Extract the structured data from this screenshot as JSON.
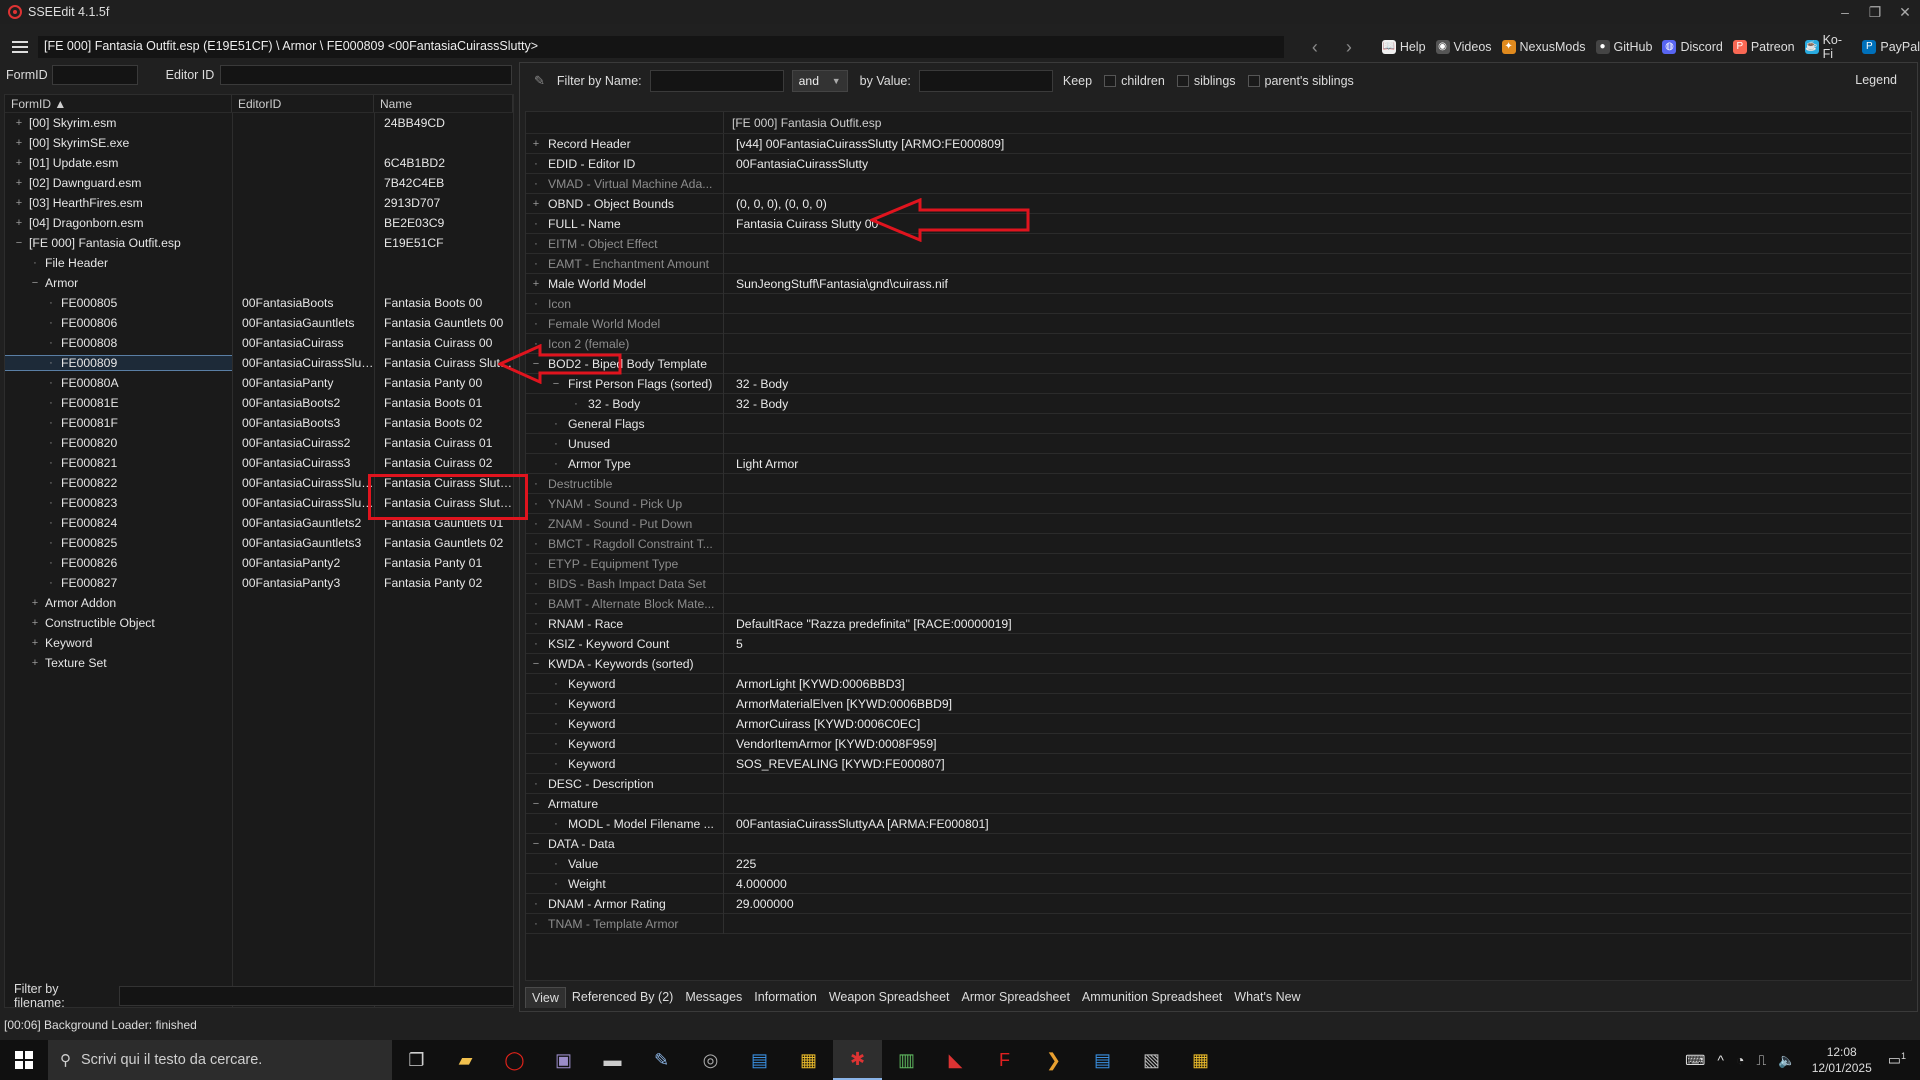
{
  "window": {
    "title": "SSEEdit 4.1.5f"
  },
  "pathbar": {
    "path": "[FE 000] Fantasia Outfit.esp (E19E51CF) \\ Armor \\ FE000809 <00FantasiaCuirassSlutty>"
  },
  "links": [
    {
      "label": "Help",
      "color": "#f0f0f0",
      "glyph": "📖"
    },
    {
      "label": "Videos",
      "color": "#555555",
      "glyph": "◉"
    },
    {
      "label": "NexusMods",
      "color": "#e08a1e",
      "glyph": "✦"
    },
    {
      "label": "GitHub",
      "color": "#444444",
      "glyph": "●"
    },
    {
      "label": "Discord",
      "color": "#5865f2",
      "glyph": "◍"
    },
    {
      "label": "Patreon",
      "color": "#f96854",
      "glyph": "P"
    },
    {
      "label": "Ko-Fi",
      "color": "#29abe0",
      "glyph": "☕"
    },
    {
      "label": "PayPal",
      "color": "#0070ba",
      "glyph": "P"
    }
  ],
  "left": {
    "formid_label": "FormID",
    "editorid_label": "Editor ID",
    "columns": [
      "FormID",
      "EditorID",
      "Name"
    ],
    "rows": [
      {
        "exp": "+",
        "level": 0,
        "c1": "[00] Skyrim.esm",
        "c2": "",
        "c3": "24BB49CD"
      },
      {
        "exp": "+",
        "level": 0,
        "c1": "[00] SkyrimSE.exe",
        "c2": "",
        "c3": ""
      },
      {
        "exp": "+",
        "level": 0,
        "c1": "[01] Update.esm",
        "c2": "",
        "c3": "6C4B1BD2"
      },
      {
        "exp": "+",
        "level": 0,
        "c1": "[02] Dawnguard.esm",
        "c2": "",
        "c3": "7B42C4EB"
      },
      {
        "exp": "+",
        "level": 0,
        "c1": "[03] HearthFires.esm",
        "c2": "",
        "c3": "2913D707"
      },
      {
        "exp": "+",
        "level": 0,
        "c1": "[04] Dragonborn.esm",
        "c2": "",
        "c3": "BE2E03C9"
      },
      {
        "exp": "−",
        "level": 0,
        "c1": "[FE 000] Fantasia Outfit.esp",
        "c2": "",
        "c3": "E19E51CF"
      },
      {
        "exp": "",
        "level": 1,
        "c1": "File Header",
        "c2": "",
        "c3": ""
      },
      {
        "exp": "−",
        "level": 1,
        "c1": "Armor",
        "c2": "",
        "c3": ""
      },
      {
        "exp": "",
        "level": 2,
        "c1": "FE000805",
        "c2": "00FantasiaBoots",
        "c3": "Fantasia Boots 00"
      },
      {
        "exp": "",
        "level": 2,
        "c1": "FE000806",
        "c2": "00FantasiaGauntlets",
        "c3": "Fantasia Gauntlets 00"
      },
      {
        "exp": "",
        "level": 2,
        "c1": "FE000808",
        "c2": "00FantasiaCuirass",
        "c3": "Fantasia Cuirass 00"
      },
      {
        "exp": "",
        "level": 2,
        "c1": "FE000809",
        "c2": "00FantasiaCuirassSlutty",
        "c3": "Fantasia Cuirass Slutt...",
        "selected": true
      },
      {
        "exp": "",
        "level": 2,
        "c1": "FE00080A",
        "c2": "00FantasiaPanty",
        "c3": "Fantasia Panty 00"
      },
      {
        "exp": "",
        "level": 2,
        "c1": "FE00081E",
        "c2": "00FantasiaBoots2",
        "c3": "Fantasia Boots 01"
      },
      {
        "exp": "",
        "level": 2,
        "c1": "FE00081F",
        "c2": "00FantasiaBoots3",
        "c3": "Fantasia Boots 02"
      },
      {
        "exp": "",
        "level": 2,
        "c1": "FE000820",
        "c2": "00FantasiaCuirass2",
        "c3": "Fantasia Cuirass 01"
      },
      {
        "exp": "",
        "level": 2,
        "c1": "FE000821",
        "c2": "00FantasiaCuirass3",
        "c3": "Fantasia Cuirass 02"
      },
      {
        "exp": "",
        "level": 2,
        "c1": "FE000822",
        "c2": "00FantasiaCuirassSlut...",
        "c3": "Fantasia Cuirass Slutt..."
      },
      {
        "exp": "",
        "level": 2,
        "c1": "FE000823",
        "c2": "00FantasiaCuirassSlut...",
        "c3": "Fantasia Cuirass Slutt..."
      },
      {
        "exp": "",
        "level": 2,
        "c1": "FE000824",
        "c2": "00FantasiaGauntlets2",
        "c3": "Fantasia Gauntlets 01"
      },
      {
        "exp": "",
        "level": 2,
        "c1": "FE000825",
        "c2": "00FantasiaGauntlets3",
        "c3": "Fantasia Gauntlets 02"
      },
      {
        "exp": "",
        "level": 2,
        "c1": "FE000826",
        "c2": "00FantasiaPanty2",
        "c3": "Fantasia Panty 01"
      },
      {
        "exp": "",
        "level": 2,
        "c1": "FE000827",
        "c2": "00FantasiaPanty3",
        "c3": "Fantasia Panty 02"
      },
      {
        "exp": "+",
        "level": 1,
        "c1": "Armor Addon",
        "c2": "",
        "c3": ""
      },
      {
        "exp": "+",
        "level": 1,
        "c1": "Constructible Object",
        "c2": "",
        "c3": ""
      },
      {
        "exp": "+",
        "level": 1,
        "c1": "Keyword",
        "c2": "",
        "c3": ""
      },
      {
        "exp": "+",
        "level": 1,
        "c1": "Texture Set",
        "c2": "",
        "c3": ""
      }
    ],
    "filter_by_filename": "Filter by filename:"
  },
  "status": "[00:06] Background Loader: finished",
  "right": {
    "filter_name_label": "Filter by Name:",
    "and_label": "and",
    "by_value_label": "by Value:",
    "keep_label": "Keep",
    "children_label": "children",
    "siblings_label": "siblings",
    "parents_label": "parent's siblings",
    "legend_label": "Legend",
    "column_header": "[FE 000] Fantasia Outfit.esp",
    "rows": [
      {
        "exp": "+",
        "ind": 0,
        "k": "Record Header",
        "v": "[v44] 00FantasiaCuirassSlutty [ARMO:FE000809]"
      },
      {
        "exp": "",
        "ind": 0,
        "k": "EDID - Editor ID",
        "v": "00FantasiaCuirassSlutty"
      },
      {
        "exp": "",
        "ind": 0,
        "k": "VMAD - Virtual Machine Ada...",
        "v": "",
        "dim": true
      },
      {
        "exp": "+",
        "ind": 0,
        "k": "OBND - Object Bounds",
        "v": "(0, 0, 0), (0, 0, 0)"
      },
      {
        "exp": "",
        "ind": 0,
        "k": "FULL - Name",
        "v": "Fantasia Cuirass Slutty 00"
      },
      {
        "exp": "",
        "ind": 0,
        "k": "EITM - Object Effect",
        "v": "",
        "dim": true
      },
      {
        "exp": "",
        "ind": 0,
        "k": "EAMT - Enchantment Amount",
        "v": "",
        "dim": true
      },
      {
        "exp": "+",
        "ind": 0,
        "k": "Male World Model",
        "v": "SunJeongStuff\\Fantasia\\gnd\\cuirass.nif"
      },
      {
        "exp": "",
        "ind": 0,
        "k": "Icon",
        "v": "",
        "dim": true
      },
      {
        "exp": "",
        "ind": 0,
        "k": "Female World Model",
        "v": "",
        "dim": true
      },
      {
        "exp": "",
        "ind": 0,
        "k": "Icon 2 (female)",
        "v": "",
        "dim": true
      },
      {
        "exp": "−",
        "ind": 0,
        "k": "BOD2 - Biped Body Template",
        "v": ""
      },
      {
        "exp": "−",
        "ind": 1,
        "k": "First Person Flags (sorted)",
        "v": "32 - Body"
      },
      {
        "exp": "",
        "ind": 2,
        "k": "32 - Body",
        "v": "32 - Body"
      },
      {
        "exp": "",
        "ind": 1,
        "k": "General Flags",
        "v": ""
      },
      {
        "exp": "",
        "ind": 1,
        "k": "Unused",
        "v": ""
      },
      {
        "exp": "",
        "ind": 1,
        "k": "Armor Type",
        "v": "Light Armor"
      },
      {
        "exp": "",
        "ind": 0,
        "k": "Destructible",
        "v": "",
        "dim": true
      },
      {
        "exp": "",
        "ind": 0,
        "k": "YNAM - Sound - Pick Up",
        "v": "",
        "dim": true
      },
      {
        "exp": "",
        "ind": 0,
        "k": "ZNAM - Sound - Put Down",
        "v": "",
        "dim": true
      },
      {
        "exp": "",
        "ind": 0,
        "k": "BMCT - Ragdoll Constraint T...",
        "v": "",
        "dim": true
      },
      {
        "exp": "",
        "ind": 0,
        "k": "ETYP - Equipment Type",
        "v": "",
        "dim": true
      },
      {
        "exp": "",
        "ind": 0,
        "k": "BIDS - Bash Impact Data Set",
        "v": "",
        "dim": true
      },
      {
        "exp": "",
        "ind": 0,
        "k": "BAMT - Alternate Block Mate...",
        "v": "",
        "dim": true
      },
      {
        "exp": "",
        "ind": 0,
        "k": "RNAM - Race",
        "v": "DefaultRace \"Razza predefinita\" [RACE:00000019]"
      },
      {
        "exp": "",
        "ind": 0,
        "k": "KSIZ - Keyword Count",
        "v": "5"
      },
      {
        "exp": "−",
        "ind": 0,
        "k": "KWDA - Keywords (sorted)",
        "v": ""
      },
      {
        "exp": "",
        "ind": 1,
        "k": "Keyword",
        "v": "ArmorLight [KYWD:0006BBD3]"
      },
      {
        "exp": "",
        "ind": 1,
        "k": "Keyword",
        "v": "ArmorMaterialElven [KYWD:0006BBD9]"
      },
      {
        "exp": "",
        "ind": 1,
        "k": "Keyword",
        "v": "ArmorCuirass [KYWD:0006C0EC]"
      },
      {
        "exp": "",
        "ind": 1,
        "k": "Keyword",
        "v": "VendorItemArmor [KYWD:0008F959]"
      },
      {
        "exp": "",
        "ind": 1,
        "k": "Keyword",
        "v": "SOS_REVEALING [KYWD:FE000807]"
      },
      {
        "exp": "",
        "ind": 0,
        "k": "DESC - Description",
        "v": ""
      },
      {
        "exp": "−",
        "ind": 0,
        "k": "Armature",
        "v": ""
      },
      {
        "exp": "",
        "ind": 1,
        "k": "MODL - Model Filename ...",
        "v": "00FantasiaCuirassSluttyAA [ARMA:FE000801]"
      },
      {
        "exp": "−",
        "ind": 0,
        "k": "DATA - Data",
        "v": ""
      },
      {
        "exp": "",
        "ind": 1,
        "k": "Value",
        "v": "225"
      },
      {
        "exp": "",
        "ind": 1,
        "k": "Weight",
        "v": "4.000000"
      },
      {
        "exp": "",
        "ind": 0,
        "k": "DNAM - Armor Rating",
        "v": "29.000000"
      },
      {
        "exp": "",
        "ind": 0,
        "k": "TNAM - Template Armor",
        "v": "",
        "dim": true
      }
    ],
    "tabs": [
      "View",
      "Referenced By (2)",
      "Messages",
      "Information",
      "Weapon Spreadsheet",
      "Armor Spreadsheet",
      "Ammunition Spreadsheet",
      "What's New"
    ]
  },
  "taskbar": {
    "search_placeholder": "Scrivi qui il testo da cercare.",
    "icons": [
      {
        "name": "task-view-icon",
        "glyph": "❐",
        "color": "#cfcfcf"
      },
      {
        "name": "file-explorer-icon",
        "glyph": "▰",
        "color": "#f2c14e"
      },
      {
        "name": "opera-icon",
        "glyph": "◯",
        "color": "#e2231a"
      },
      {
        "name": "app-icon-1",
        "glyph": "▣",
        "color": "#9b8cc9"
      },
      {
        "name": "app-icon-2",
        "glyph": "▬",
        "color": "#cccccc"
      },
      {
        "name": "app-icon-3",
        "glyph": "✎",
        "color": "#8fb8e8"
      },
      {
        "name": "app-icon-4",
        "glyph": "◎",
        "color": "#aaaaaa"
      },
      {
        "name": "app-icon-5",
        "glyph": "▤",
        "color": "#3a8fe0"
      },
      {
        "name": "app-icon-6",
        "glyph": "▦",
        "color": "#e8b92a"
      },
      {
        "name": "sseedit-icon",
        "glyph": "✱",
        "color": "#d33",
        "active": true
      },
      {
        "name": "app-icon-7",
        "glyph": "▥",
        "color": "#5fb85f"
      },
      {
        "name": "app-icon-8",
        "glyph": "◣",
        "color": "#d33"
      },
      {
        "name": "app-icon-9",
        "glyph": "F",
        "color": "#e02020"
      },
      {
        "name": "app-icon-10",
        "glyph": "❯",
        "color": "#e8a030"
      },
      {
        "name": "app-icon-11",
        "glyph": "▤",
        "color": "#3a8fe0"
      },
      {
        "name": "app-icon-12",
        "glyph": "▧",
        "color": "#bbbbbb"
      },
      {
        "name": "app-icon-13",
        "glyph": "▦",
        "color": "#e8b92a"
      }
    ],
    "time": "12:08",
    "date": "12/01/2025",
    "notifications": "1"
  }
}
